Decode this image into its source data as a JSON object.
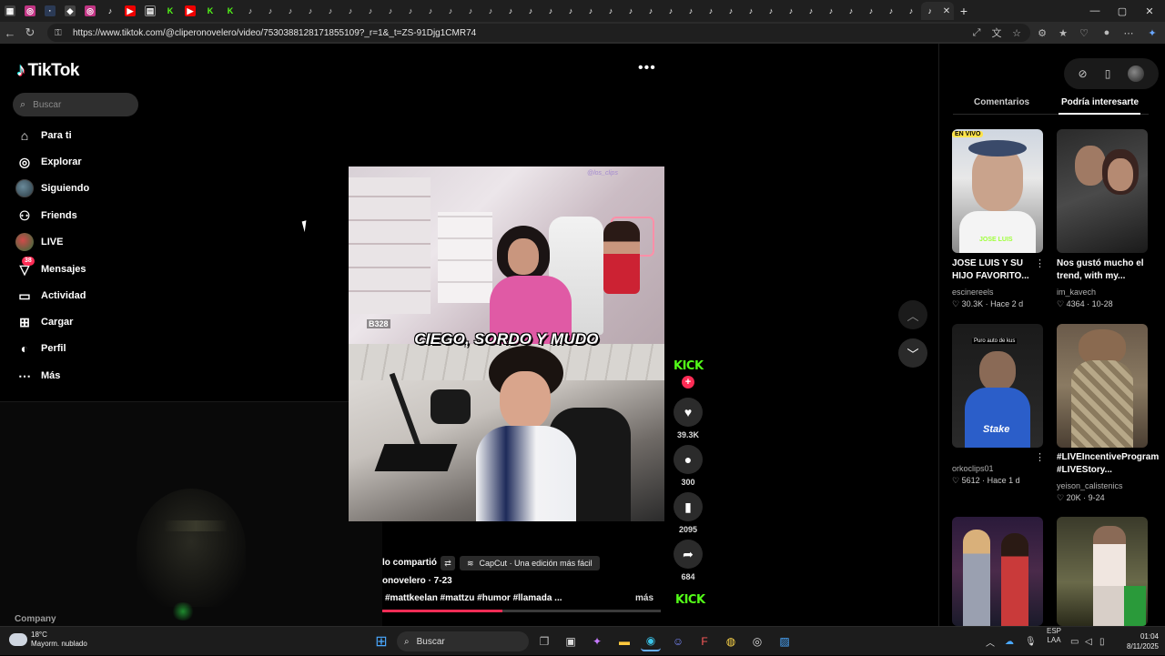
{
  "browser": {
    "url": "https://www.tiktok.com/@cliperonovelero/video/7530388128171855109?_r=1&_t=ZS-91Djg1CMR74",
    "window_controls": [
      "—",
      "▢",
      "✕"
    ],
    "new_tab": "+"
  },
  "sidebar": {
    "logo": "TikTok",
    "search_placeholder": "Buscar",
    "items": [
      {
        "label": "Para ti",
        "icon": "home-icon"
      },
      {
        "label": "Explorar",
        "icon": "compass-icon"
      },
      {
        "label": "Siguiendo",
        "icon": "following-avatar"
      },
      {
        "label": "Friends",
        "icon": "friends-icon"
      },
      {
        "label": "LIVE",
        "icon": "live-avatar"
      },
      {
        "label": "Mensajes",
        "icon": "messages-icon",
        "badge": "38"
      },
      {
        "label": "Actividad",
        "icon": "activity-icon"
      },
      {
        "label": "Cargar",
        "icon": "upload-icon"
      },
      {
        "label": "Perfil",
        "icon": "profile-icon"
      },
      {
        "label": "Más",
        "icon": "more-icon"
      }
    ],
    "company": "Company"
  },
  "video": {
    "caption": "CIEGO, SORDO Y MUDO",
    "counter": "B328",
    "watermark": "@los_clips",
    "brand_badge": "KICK",
    "likes": "39.3K",
    "comments": "300",
    "saves": "2095",
    "shares": "684",
    "shared_by": "lo compartió",
    "capcut": "CapCut · Una edición más fácil",
    "author_date": "onovelero · 7-23",
    "hashtags": "#mattkeelan #mattzu #humor #llamada ...",
    "more": "más",
    "progress": 0.43
  },
  "right_panel": {
    "tabs": [
      "Comentarios",
      "Podría interesarte"
    ],
    "active_tab": "Podría interesarte",
    "cards": [
      {
        "title": "JOSE LUIS Y SU HIJO FAVORITO...",
        "user": "escinereels",
        "likes": "30.3K",
        "date": "Hace 2 d",
        "thumb_text": "JOSE LUIS"
      },
      {
        "title": "Nos gustó mucho el trend, with my...",
        "user": "im_kavech",
        "likes": "4364",
        "date": "10-28",
        "thumb_text": ""
      },
      {
        "title": "",
        "user": "orkoclips01",
        "likes": "5612",
        "date": "Hace 1 d",
        "thumb_text": "Stake"
      },
      {
        "title": "#LIVEIncentiveProgram #LIVEStory...",
        "user": "yeison_calistenics",
        "likes": "20K",
        "date": "9-24",
        "thumb_text": ""
      }
    ]
  },
  "taskbar": {
    "temp": "18°C",
    "weather": "Mayorm. nublado",
    "search": "Buscar",
    "lang": "ESP",
    "lang2": "LAA",
    "time": "01:04",
    "date": "8/11/2025"
  },
  "colors": {
    "accent": "#fe2c55",
    "kick": "#53fc18",
    "bg": "#000000"
  }
}
